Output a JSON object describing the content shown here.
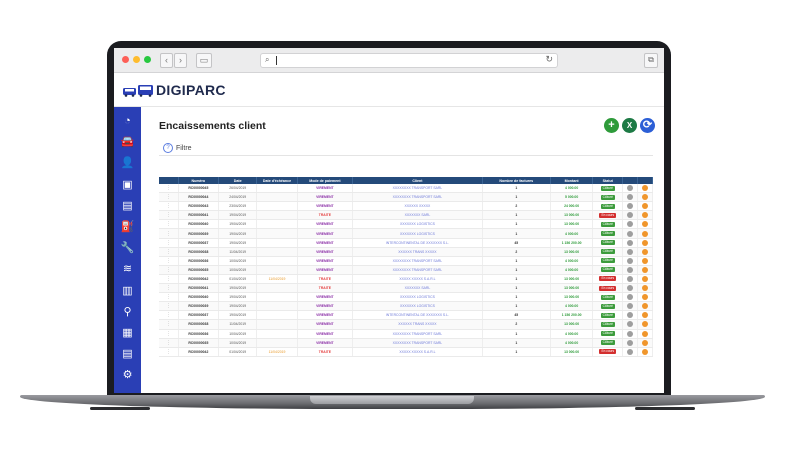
{
  "header": {
    "brand": "DIGIPARC"
  },
  "page": {
    "title": "Encaissements client",
    "filter_label": "Filtre",
    "add_icon": "+",
    "excel_icon": "X",
    "refresh_icon": "⟳"
  },
  "colors": {
    "sidebar": "#2a3fb5",
    "table_header": "#244a7a",
    "add": "#2e9b3a",
    "excel": "#1d7a45",
    "refresh": "#2c5fd6"
  },
  "sidebar": {
    "icons": [
      "dashboard-icon",
      "car-icon",
      "user-icon",
      "contract-icon",
      "document-icon",
      "fuel-icon",
      "wrench-icon",
      "layers-icon",
      "building-icon",
      "location-icon",
      "vehicle-front-icon",
      "invoice-icon",
      "settings-icon"
    ],
    "glyphs": [
      "◔",
      "🚘",
      "👤",
      "▣",
      "▤",
      "⛽",
      "🔧",
      "≋",
      "▥",
      "⚲",
      "▦",
      "▤",
      "⚙"
    ]
  },
  "table": {
    "headers": [
      "",
      "Numéro",
      "Date",
      "Date d'échéance",
      "Mode de paiement",
      "Client",
      "Nombre de factures",
      "Montant",
      "Statut",
      "",
      ""
    ],
    "rows": [
      {
        "num": "RC00000045",
        "date": "26/04/2019",
        "ech": "",
        "mode": "VIREMENT",
        "client": "XXXXXXXX TRANSPORT SARL",
        "fac": "1",
        "amt": "4 000.00",
        "status": "Clôturé"
      },
      {
        "num": "RC00000044",
        "date": "24/04/2019",
        "ech": "",
        "mode": "VIREMENT",
        "client": "XXXXXXXX TRANSPORT SARL",
        "fac": "1",
        "amt": "5 000.00",
        "status": "Clôturé"
      },
      {
        "num": "RC00000043",
        "date": "23/04/2019",
        "ech": "",
        "mode": "VIREMENT",
        "client": "XXXXXX XXXXX",
        "fac": "2",
        "amt": "24 000.00",
        "status": "Clôturé"
      },
      {
        "num": "RC00000041",
        "date": "19/04/2019",
        "ech": "",
        "mode": "TRAITE",
        "client": "XXXXXXX SARL",
        "fac": "1",
        "amt": "13 000.00",
        "status": "En cours"
      },
      {
        "num": "RC00000040",
        "date": "19/04/2019",
        "ech": "",
        "mode": "VIREMENT",
        "client": "XXXXXXX LOGISTICS",
        "fac": "1",
        "amt": "13 000.00",
        "status": "Clôturé"
      },
      {
        "num": "RC00000039",
        "date": "19/04/2019",
        "ech": "",
        "mode": "VIREMENT",
        "client": "XXXXXXX LOGISTICS",
        "fac": "1",
        "amt": "4 000.00",
        "status": "Clôturé"
      },
      {
        "num": "RC00000037",
        "date": "19/04/2019",
        "ech": "",
        "mode": "VIREMENT",
        "client": "INTERCONTINENTAL DE XXXXXXX S.L.",
        "fac": "45",
        "amt": "1 156 200.00",
        "status": "Clôturé"
      },
      {
        "num": "RC00000038",
        "date": "11/04/2019",
        "ech": "",
        "mode": "VIREMENT",
        "client": "XXXXXX TRANS XXXXX",
        "fac": "2",
        "amt": "13 000.00",
        "status": "Clôturé"
      },
      {
        "num": "RC00000036",
        "date": "10/04/2019",
        "ech": "",
        "mode": "VIREMENT",
        "client": "XXXXXXXX TRANSPORT SARL",
        "fac": "1",
        "amt": "4 000.00",
        "status": "Clôturé"
      },
      {
        "num": "RC00000035",
        "date": "10/04/2019",
        "ech": "",
        "mode": "VIREMENT",
        "client": "XXXXXXXX TRANSPORT SARL",
        "fac": "1",
        "amt": "4 000.00",
        "status": "Clôturé"
      },
      {
        "num": "RC00000042",
        "date": "01/04/2019",
        "ech": "11/04/2019",
        "mode": "TRAITE",
        "client": "XXXXX XXXXX S.A.R.L",
        "fac": "1",
        "amt": "13 000.00",
        "status": "En cours"
      },
      {
        "num": "RC00000041",
        "date": "19/04/2019",
        "ech": "",
        "mode": "TRAITE",
        "client": "XXXXXXX SARL",
        "fac": "1",
        "amt": "13 000.00",
        "status": "En cours"
      },
      {
        "num": "RC00000040",
        "date": "19/04/2019",
        "ech": "",
        "mode": "VIREMENT",
        "client": "XXXXXXX LOGISTICS",
        "fac": "1",
        "amt": "13 000.00",
        "status": "Clôturé"
      },
      {
        "num": "RC00000039",
        "date": "19/04/2019",
        "ech": "",
        "mode": "VIREMENT",
        "client": "XXXXXXX LOGISTICS",
        "fac": "1",
        "amt": "4 000.00",
        "status": "Clôturé"
      },
      {
        "num": "RC00000037",
        "date": "19/04/2019",
        "ech": "",
        "mode": "VIREMENT",
        "client": "INTERCONTINENTAL DE XXXXXXX S.L.",
        "fac": "45",
        "amt": "1 156 200.00",
        "status": "Clôturé"
      },
      {
        "num": "RC00000038",
        "date": "11/04/2019",
        "ech": "",
        "mode": "VIREMENT",
        "client": "XXXXXX TRANS XXXXX",
        "fac": "2",
        "amt": "13 000.00",
        "status": "Clôturé"
      },
      {
        "num": "RC00000036",
        "date": "10/04/2019",
        "ech": "",
        "mode": "VIREMENT",
        "client": "XXXXXXXX TRANSPORT SARL",
        "fac": "1",
        "amt": "4 000.00",
        "status": "Clôturé"
      },
      {
        "num": "RC00000035",
        "date": "10/04/2019",
        "ech": "",
        "mode": "VIREMENT",
        "client": "XXXXXXXX TRANSPORT SARL",
        "fac": "1",
        "amt": "4 000.00",
        "status": "Clôturé"
      },
      {
        "num": "RC00000042",
        "date": "01/04/2019",
        "ech": "11/04/2019",
        "mode": "TRAITE",
        "client": "XXXXX XXXXX S.A.R.L",
        "fac": "1",
        "amt": "13 000.00",
        "status": "En cours"
      }
    ]
  }
}
